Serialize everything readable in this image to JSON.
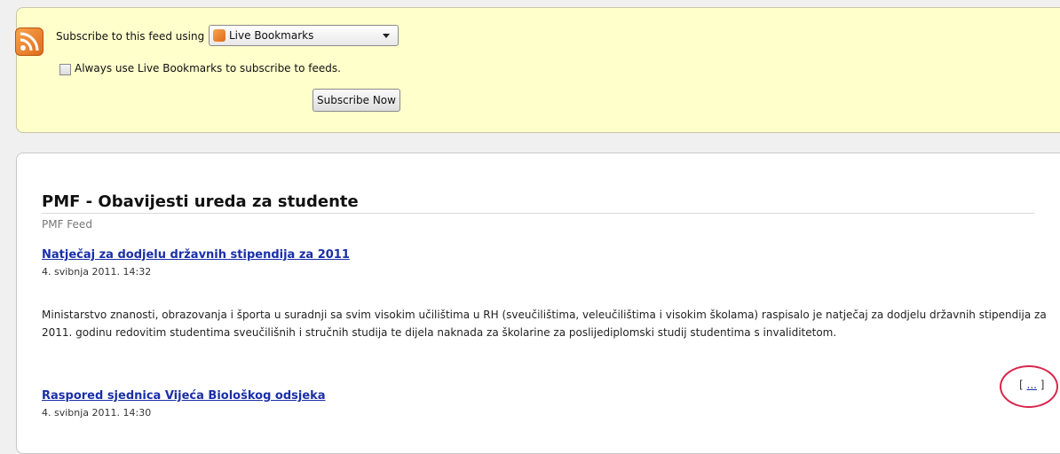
{
  "subscribe": {
    "label": "Subscribe to this feed using",
    "reader_selected": "Live Bookmarks",
    "always_use_label": "Always use Live Bookmarks to subscribe to feeds.",
    "always_use_checked": false,
    "button_label": "Subscribe Now"
  },
  "feed": {
    "title": "PMF - Obavijesti ureda za studente",
    "subtitle": "PMF Feed",
    "entries": [
      {
        "title": "Natječaj za dodjelu državnih stipendija za 2011",
        "date": "4. svibnja 2011. 14:32",
        "description": "Ministarstvo znanosti, obrazovanja i športa u suradnji sa svim visokim učilištima u RH (sveučilištima, veleučilištima i visokim školama) raspisalo je natječaj za dodjelu državnih stipendija za 2011. godinu redovitim studentima sveučilišnih i stručnih studija te dijela naknada za školarine za poslijediplomski studij studentima s invaliditetom.",
        "more_open": "[ ",
        "more_link": "...",
        "more_close": " ]"
      },
      {
        "title": "Raspored sjednica Vijeća Biološkog odsjeka",
        "date": "4. svibnja 2011. 14:30"
      }
    ]
  },
  "colors": {
    "link": "#1a2fa8",
    "subscribe_bg": "#ffffcc",
    "annotation_circle": "#d9254c"
  }
}
